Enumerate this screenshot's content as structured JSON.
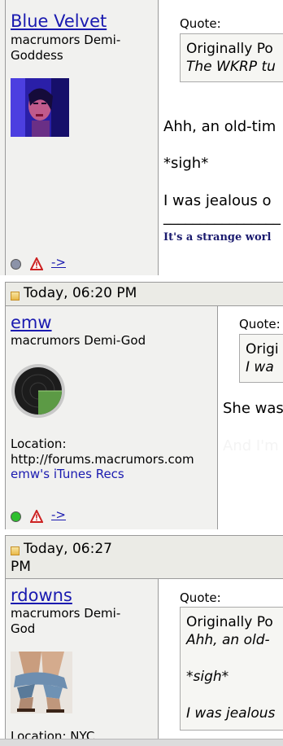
{
  "posts": [
    {
      "username": "Blue Velvet",
      "user_title": "macrumors Demi-Goddess",
      "avatar_icon": "woman-face-avatar",
      "quote_label": "Quote:",
      "quote_head": "Originally Po",
      "quote_body": "The WKRP tu",
      "lines": [
        "Ahh, an old-tim",
        "*sigh*",
        "I was jealous o"
      ],
      "sig_rule": "________________",
      "signature": "It's a strange worl",
      "arrow": "->",
      "status": "offline"
    },
    {
      "date": "Today, 06:20 PM",
      "username": "emw",
      "user_title": "macrumors Demi-God",
      "avatar_icon": "radar-avatar",
      "location_label": "Location:",
      "location_value": "http://forums.macrumors.com",
      "itunes_link": "emw's iTunes Recs",
      "quote_label": "Quote:",
      "quote_head": "Origi",
      "quote_body": "I wa",
      "lines": [
        "She was",
        "And I'm"
      ],
      "arrow": "->",
      "status": "online"
    },
    {
      "date_line1": "Today, 06:27",
      "date_line2": "PM",
      "username": "rdowns",
      "user_title": "macrumors Demi-God",
      "avatar_icon": "jeans-feet-avatar",
      "location_label": "Location: NYC",
      "quote_label": "Quote:",
      "quote_head": "Originally Po",
      "quote_lines": [
        "Ahh, an old-",
        "*sigh*",
        "I was jealous"
      ]
    }
  ],
  "colors": {
    "link": "#1a1ab0",
    "sidebar_bg": "#f1f1ef",
    "date_band": "#ebebe6"
  }
}
